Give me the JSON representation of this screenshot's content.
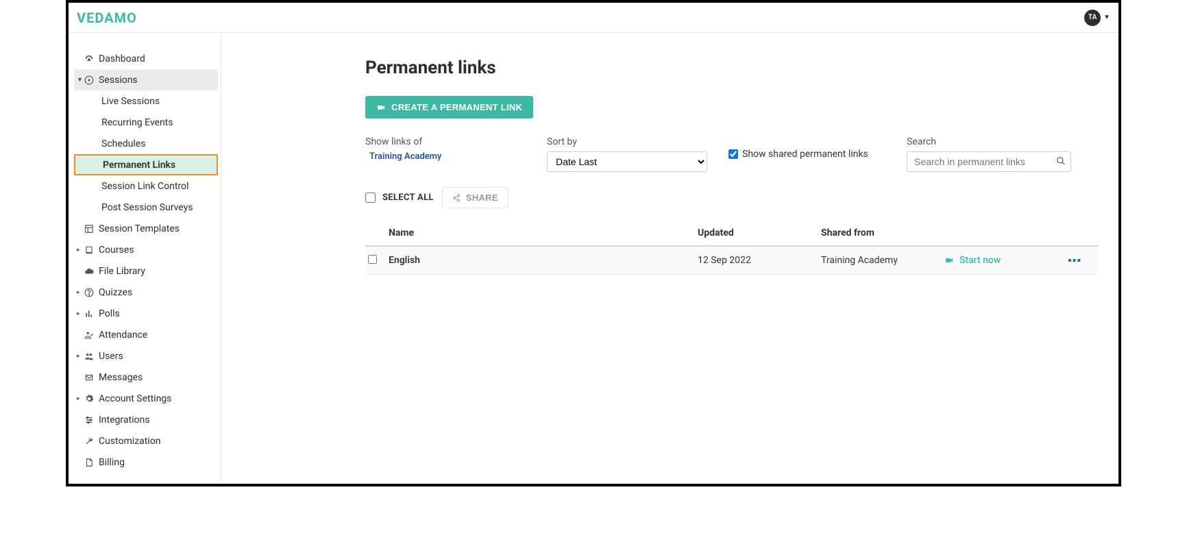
{
  "header": {
    "logo_text": "VEDAMO",
    "avatar_initials": "TA"
  },
  "sidebar": {
    "items": [
      {
        "label": "Dashboard",
        "icon": "gauge",
        "expandable": false
      },
      {
        "label": "Sessions",
        "icon": "play",
        "expandable": true,
        "expanded": true,
        "children": [
          {
            "label": "Live Sessions"
          },
          {
            "label": "Recurring Events"
          },
          {
            "label": "Schedules"
          },
          {
            "label": "Permanent Links",
            "active": true
          },
          {
            "label": "Session Link Control"
          },
          {
            "label": "Post Session Surveys"
          }
        ]
      },
      {
        "label": "Session Templates",
        "icon": "template",
        "expandable": false
      },
      {
        "label": "Courses",
        "icon": "book",
        "expandable": true
      },
      {
        "label": "File Library",
        "icon": "cloud",
        "expandable": false
      },
      {
        "label": "Quizzes",
        "icon": "question",
        "expandable": true
      },
      {
        "label": "Polls",
        "icon": "poll",
        "expandable": true
      },
      {
        "label": "Attendance",
        "icon": "person-check",
        "expandable": false
      },
      {
        "label": "Users",
        "icon": "users",
        "expandable": true
      },
      {
        "label": "Messages",
        "icon": "envelope",
        "expandable": false
      },
      {
        "label": "Account Settings",
        "icon": "gear",
        "expandable": true
      },
      {
        "label": "Integrations",
        "icon": "sliders",
        "expandable": false
      },
      {
        "label": "Customization",
        "icon": "wrench",
        "expandable": false
      },
      {
        "label": "Billing",
        "icon": "file",
        "expandable": false
      }
    ]
  },
  "page": {
    "title": "Permanent links",
    "create_button_label": "CREATE A PERMANENT LINK",
    "filters": {
      "show_links_label": "Show links of",
      "show_links_value": "Training Academy",
      "sort_label": "Sort by",
      "sort_value": "Date Last",
      "shared_checkbox_label": "Show shared permanent links",
      "shared_checked": true,
      "search_label": "Search",
      "search_placeholder": "Search in permanent links"
    },
    "select_all_label": "SELECT ALL",
    "share_label": "SHARE",
    "table": {
      "headers": {
        "name": "Name",
        "updated": "Updated",
        "shared_from": "Shared from"
      },
      "rows": [
        {
          "name": "English",
          "updated": "12 Sep 2022",
          "shared_from": "Training Academy",
          "start_label": "Start now"
        }
      ]
    }
  }
}
